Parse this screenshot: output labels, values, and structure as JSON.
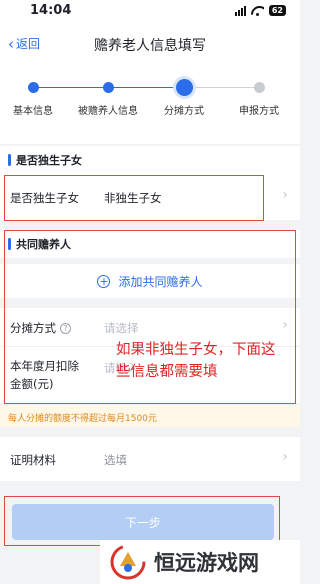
{
  "status_bar": {
    "time": "14:04",
    "battery": "62"
  },
  "nav": {
    "back_label": "返回",
    "title": "赡养老人信息填写"
  },
  "steps": [
    {
      "label": "基本信息",
      "state": "done"
    },
    {
      "label": "被赡养人信息",
      "state": "done"
    },
    {
      "label": "分摊方式",
      "state": "current"
    },
    {
      "label": "申报方式",
      "state": "pending"
    }
  ],
  "only_child_section": {
    "title": "是否独生子女",
    "field_label": "是否独生子女",
    "field_value": "非独生子女"
  },
  "co_supporter_section": {
    "title": "共同赡养人",
    "add_label": "添加共同赡养人"
  },
  "split_method": {
    "label": "分摊方式",
    "placeholder": "请选择"
  },
  "monthly_deduction": {
    "label_line1": "本年度月扣除",
    "label_line2": "金额(元)",
    "placeholder": "请输入"
  },
  "notice": "每人分摊的额度不得超过每月1500元",
  "proof": {
    "label": "证明材料",
    "placeholder": "选填"
  },
  "next_button": "下一步",
  "annotation": "如果非独生子女，下面这些信息都需要填",
  "watermark": "恒远游戏网",
  "colors": {
    "accent": "#2b6de8",
    "annotation_red": "#e02424",
    "notice_orange": "#e08a1e"
  }
}
